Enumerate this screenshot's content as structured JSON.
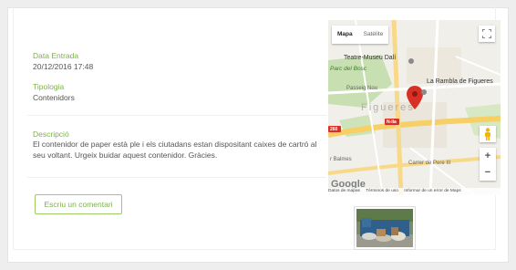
{
  "fields": {
    "date_label": "Data Entrada",
    "date_value": "20/12/2016 17:48",
    "type_label": "Tipologia",
    "type_value": "Contenidors",
    "desc_label": "Descripció",
    "desc_value": "El contenidor de paper està ple i els ciutadans estan dispositant caixes de cartró al seu voltant. Urgeix buidar aquest contenidor. Gràcies."
  },
  "actions": {
    "comment_button": "Escriu un comentari"
  },
  "map": {
    "tab_map": "Mapa",
    "tab_satellite": "Satèlite",
    "labels": {
      "museum": "Teatre-Museu Dalí",
      "rambla": "La Rambla de Figueres",
      "park": "Parc del Bosc",
      "city": "Figueres",
      "street1": "Passeig Nou",
      "street2": "Carrer de Pere III",
      "street3": "r Balmes",
      "road1": "260",
      "road2": "N-IIa"
    },
    "attribution": [
      "Datos de mapas",
      "Términos de uso",
      "Informar de un error de Maps"
    ],
    "google": "Google",
    "zoom_in": "+",
    "zoom_out": "−"
  },
  "colors": {
    "accent": "#7cb342",
    "marker": "#d93025"
  }
}
